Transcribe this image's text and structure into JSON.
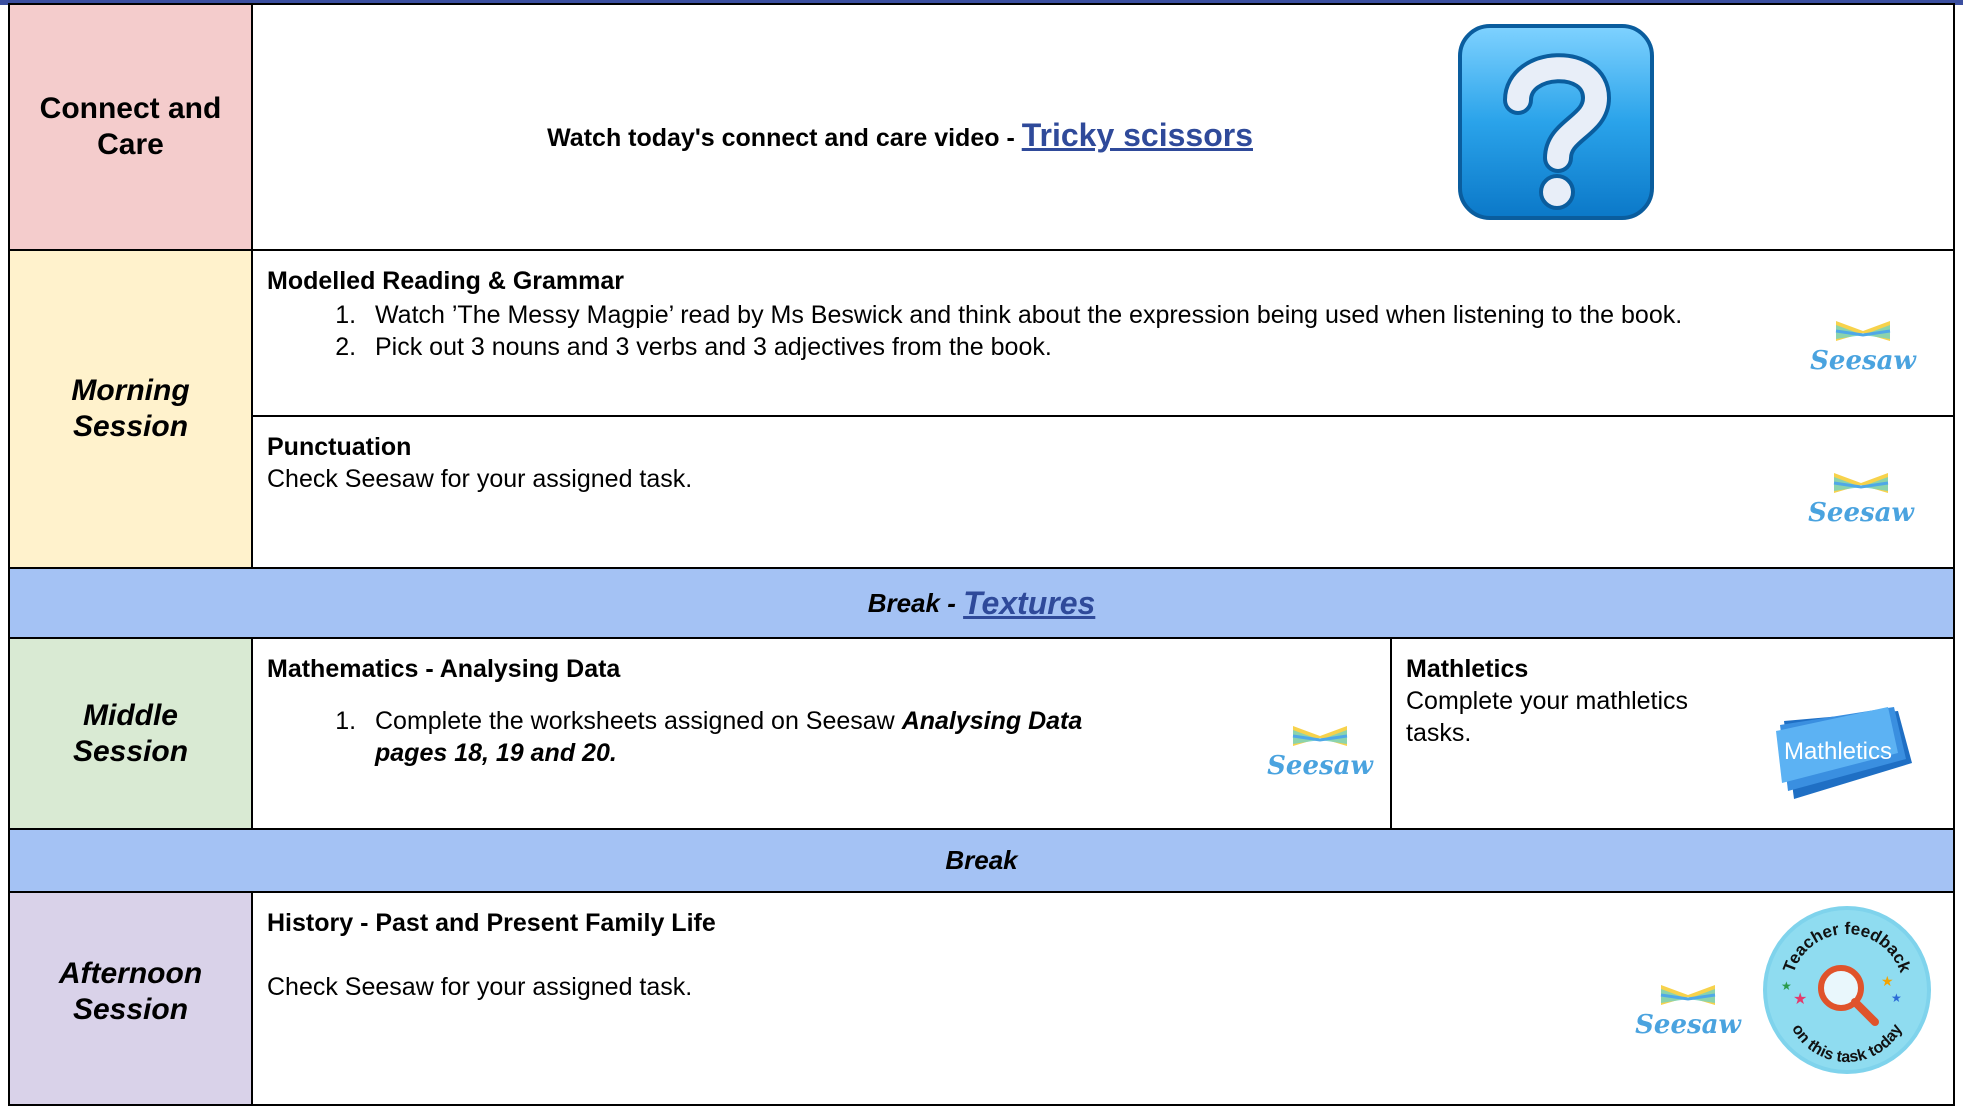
{
  "rows": {
    "connect": {
      "label": "Connect and Care",
      "text": "Watch today's connect and care video - ",
      "link": "Tricky scissors",
      "icon": "question-mark-icon"
    },
    "morning": {
      "label": "Morning Session",
      "reading": {
        "heading": "Modelled Reading & Grammar",
        "items": [
          "Watch ’The Messy Magpie’ read by Ms Beswick and think about the expression being used when listening to the book.",
          "Pick out 3 nouns and 3 verbs and 3 adjectives from the book."
        ]
      },
      "punctuation": {
        "heading": "Punctuation",
        "text": "Check Seesaw for your assigned task."
      }
    },
    "break1": {
      "prefix": "Break - ",
      "link": "Textures"
    },
    "middle": {
      "label": "Middle Session",
      "maths": {
        "heading": "Mathematics - Analysing Data",
        "item_text": "Complete the worksheets assigned on Seesaw ",
        "item_bold": "Analysing Data pages 18, 19 and 20."
      },
      "mathletics": {
        "heading": "Mathletics",
        "text": "Complete your mathletics tasks.",
        "logo": "Mathletics"
      }
    },
    "break2": {
      "label": "Break"
    },
    "afternoon": {
      "label": "Afternoon Session",
      "heading": "History - Past and Present Family Life",
      "text": "Check Seesaw for your assigned task.",
      "badge_top": "Teacher feedback",
      "badge_bottom": "on this task today"
    }
  },
  "seesaw_label": "Seesaw",
  "colors": {
    "connect_bg": "#f4cccc",
    "morning_bg": "#fff2cc",
    "break_bg": "#a4c2f4",
    "middle_bg": "#d9ead3",
    "afternoon_bg": "#d9d2e9",
    "link": "#2f4a9a"
  }
}
